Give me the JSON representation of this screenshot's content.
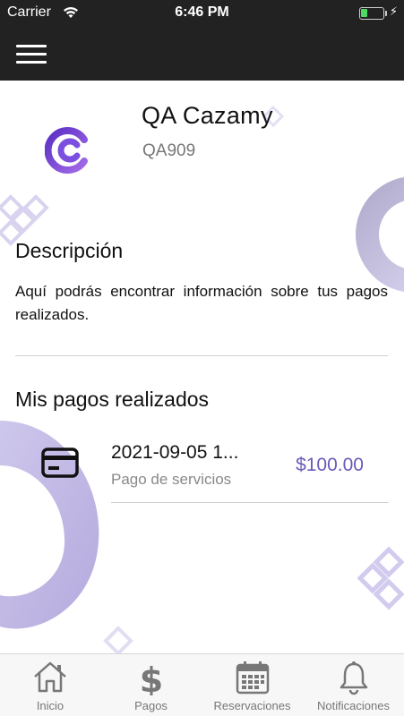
{
  "status_bar": {
    "carrier": "Carrier",
    "time": "6:46 PM",
    "battery_color": "#4cd964"
  },
  "app_bar": {
    "menu_icon": "hamburger-menu-icon",
    "background": "#222222"
  },
  "profile": {
    "name": "QA Cazamy",
    "code": "QA909",
    "logo_icon": "cazamy-logo",
    "brand_color": "#7b4fd6"
  },
  "description": {
    "title": "Descripción",
    "text": "Aquí podrás encontrar información sobre tus pagos realizados."
  },
  "payments": {
    "title": "Mis pagos realizados",
    "items": [
      {
        "date": "2021-09-05 1...",
        "type": "Pago de servicios",
        "amount": "$100.00",
        "icon": "credit-card-icon"
      }
    ],
    "amount_color": "#6b5ab8"
  },
  "tab_bar": {
    "items": [
      {
        "label": "Inicio",
        "icon": "home-icon"
      },
      {
        "label": "Pagos",
        "icon": "dollar-icon"
      },
      {
        "label": "Reservaciones",
        "icon": "calendar-icon"
      },
      {
        "label": "Notificaciones",
        "icon": "bell-icon"
      }
    ]
  }
}
